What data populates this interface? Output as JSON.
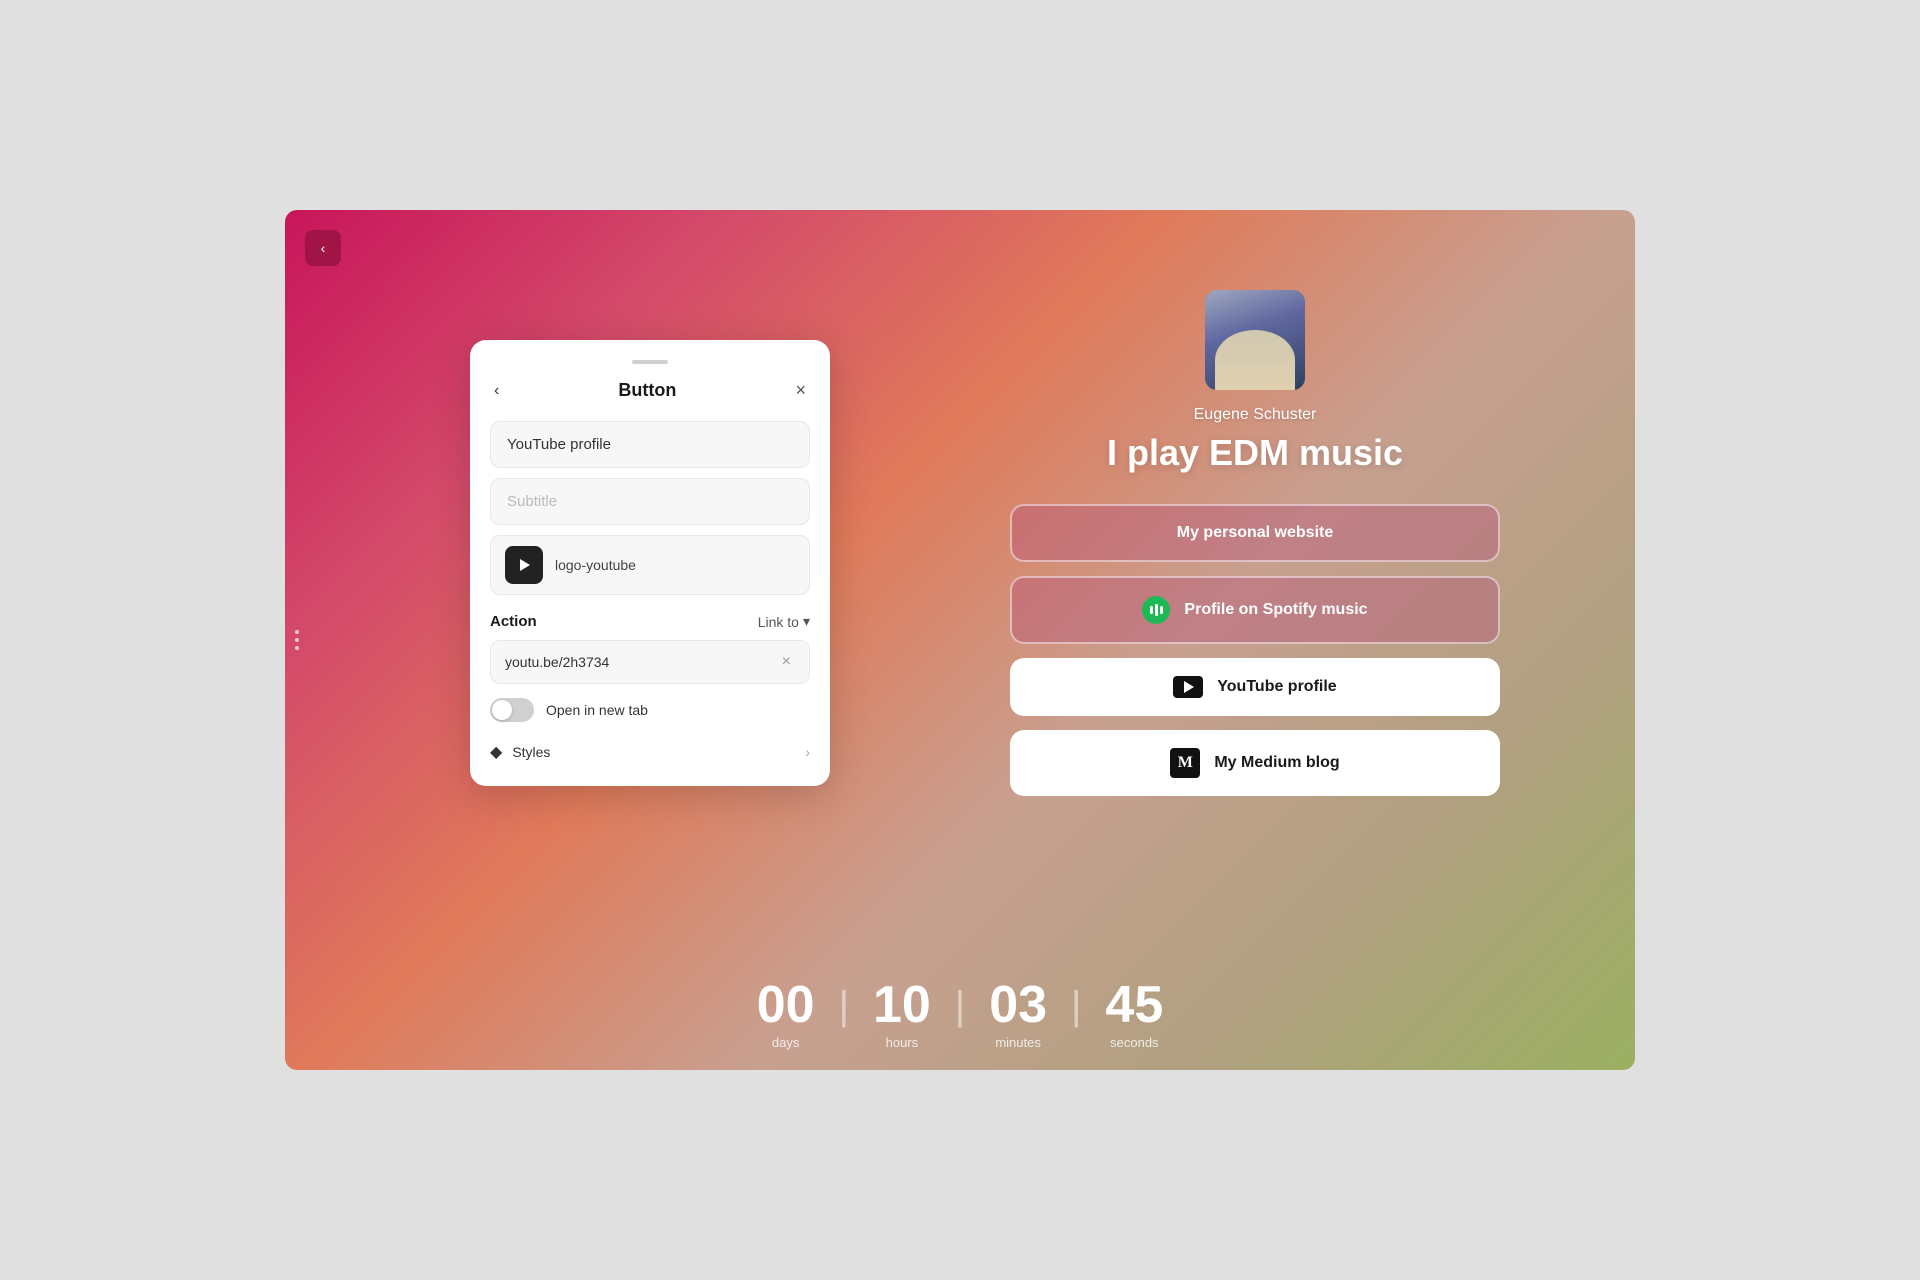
{
  "screen": {
    "background_gradient": "linear-gradient(135deg, #c8155a 0%, #d44a6a 20%, #e07a5a 40%, #c8a090 60%, #b0a080 80%, #9ab060 100%)"
  },
  "collapse_btn": {
    "icon": "‹"
  },
  "modal": {
    "title": "Button",
    "back_icon": "‹",
    "close_icon": "×",
    "title_input": {
      "value": "YouTube profile",
      "placeholder": "YouTube profile"
    },
    "subtitle_input": {
      "value": "",
      "placeholder": "Subtitle"
    },
    "icon_selector": {
      "label": "logo-youtube"
    },
    "action": {
      "label": "Action",
      "link_label": "Link to",
      "chevron": "▾"
    },
    "url_input": {
      "value": "youtu.be/2h3734",
      "placeholder": ""
    },
    "toggle": {
      "label": "Open in new tab",
      "active": false
    },
    "styles": {
      "label": "Styles",
      "chevron": "›"
    }
  },
  "profile": {
    "name": "Eugene Schuster",
    "title": "I play EDM music"
  },
  "buttons": [
    {
      "label": "My personal website",
      "type": "outline",
      "icon": null
    },
    {
      "label": "Profile on Spotify music",
      "type": "outline",
      "icon": "spotify"
    },
    {
      "label": "YouTube profile",
      "type": "white",
      "icon": "youtube"
    },
    {
      "label": "My Medium blog",
      "type": "white",
      "icon": "medium"
    }
  ],
  "countdown": {
    "days": {
      "value": "00",
      "label": "days"
    },
    "hours": {
      "value": "10",
      "label": "hours"
    },
    "minutes": {
      "value": "03",
      "label": "minutes"
    },
    "seconds": {
      "value": "45",
      "label": "seconds"
    }
  }
}
